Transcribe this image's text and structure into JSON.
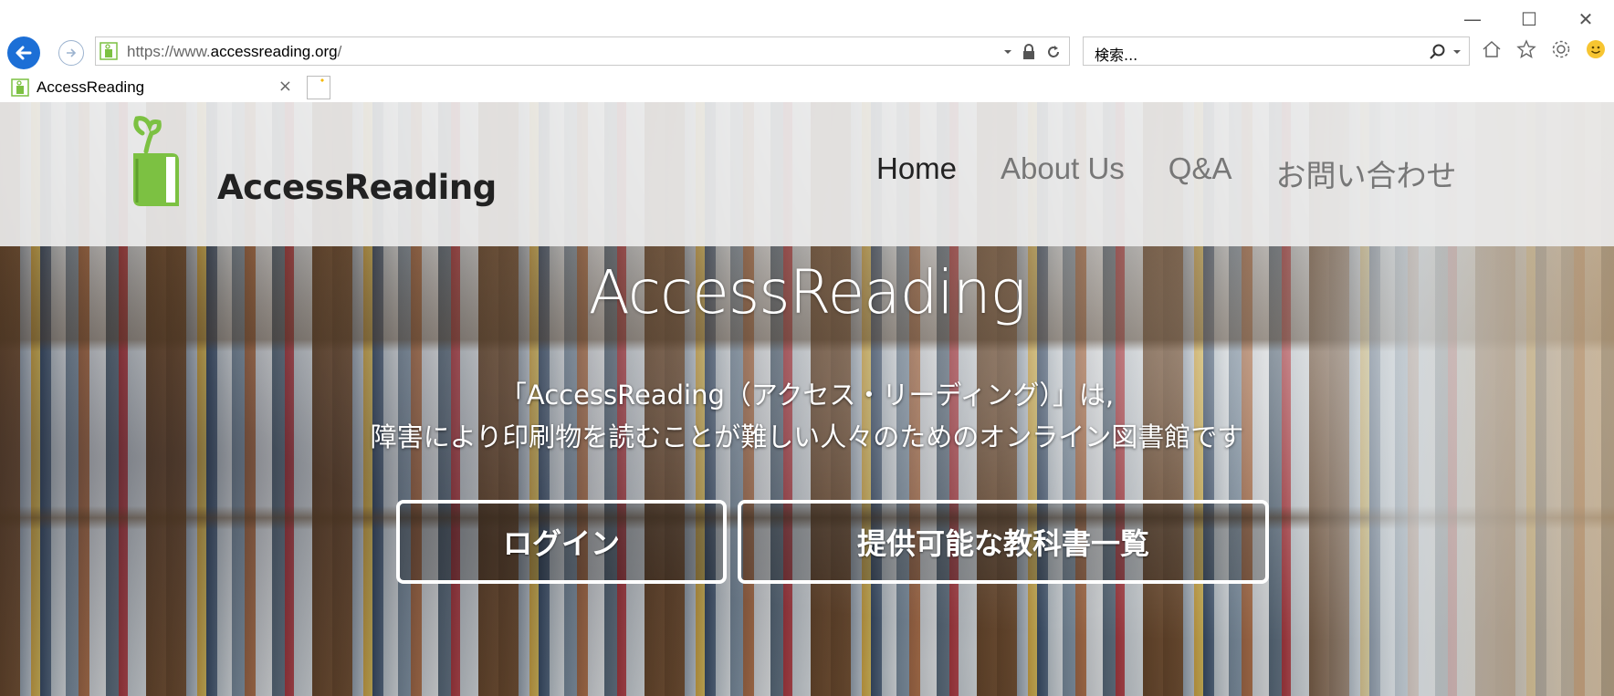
{
  "browser": {
    "url_host_prefix": "https://www.",
    "url_host": "accessreading.org",
    "url_suffix": "/",
    "search_placeholder": "検索...",
    "tab_title": "AccessReading",
    "tab_close": "×",
    "win_minimize": "—",
    "win_maximize": "☐",
    "win_close": "✕"
  },
  "site": {
    "logo_text": "AccessReading",
    "nav": [
      {
        "label": "Home",
        "active": true
      },
      {
        "label": "About Us",
        "active": false
      },
      {
        "label": "Q&A",
        "active": false
      },
      {
        "label": "お問い合わせ",
        "active": false
      }
    ]
  },
  "hero": {
    "title": "AccessReading",
    "subtitle_line1": "「AccessReading（アクセス・リーディング）」は,",
    "subtitle_line2": "障害により印刷物を読むことが難しい人々のためのオンライン図書館です",
    "login_button": "ログイン",
    "textbook_list_button": "提供可能な教科書一覧"
  },
  "colors": {
    "back_button": "#1c6fd6",
    "logo_green": "#7cc142",
    "nav_active": "#222222",
    "nav_inactive": "#777777"
  }
}
